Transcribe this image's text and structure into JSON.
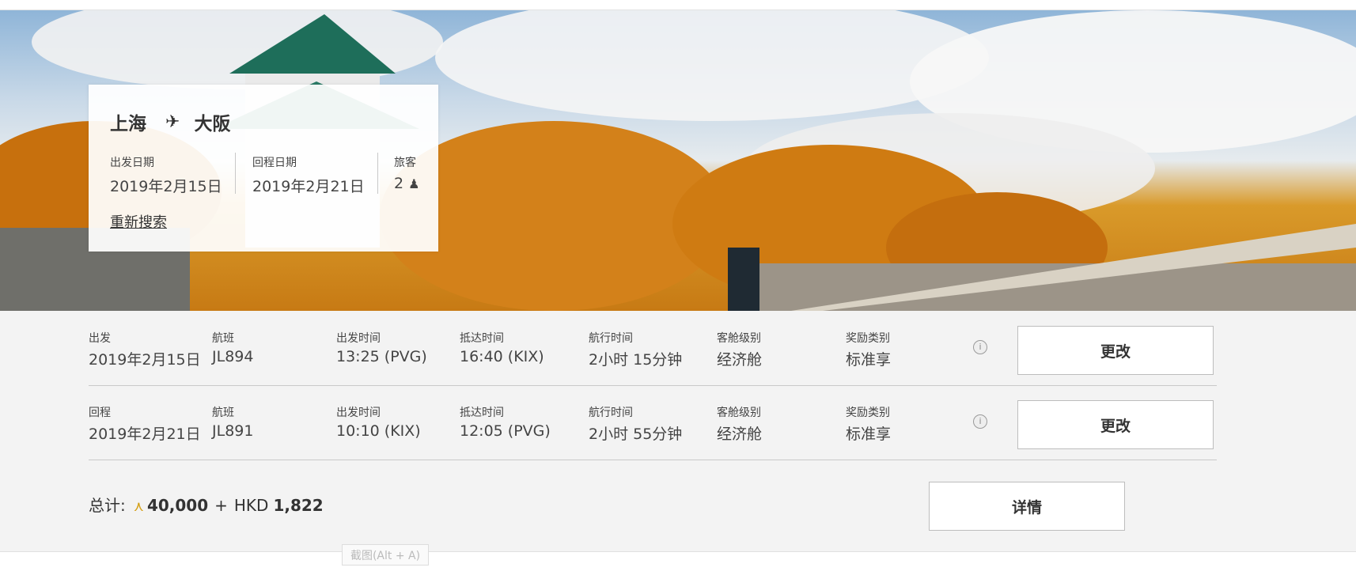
{
  "search": {
    "origin": "上海",
    "destination": "大阪",
    "route_icon": "plane-icon",
    "depart_label": "出发日期",
    "depart_value": "2019年2月15日",
    "return_label": "回程日期",
    "return_value": "2019年2月21日",
    "pax_label": "旅客",
    "pax_value": "2",
    "pax_icon": "person-icon",
    "research_label": "重新搜索"
  },
  "flights": [
    {
      "leg_label": "出发",
      "leg_date": "2019年2月15日",
      "flight_label": "航班",
      "flight_no": "JL894",
      "dep_label": "出发时间",
      "dep_time": "13:25 (PVG)",
      "arr_label": "抵达时间",
      "arr_time": "16:40 (KIX)",
      "dur_label": "航行时间",
      "duration": "2小时 15分钟",
      "cabin_label": "客舱级别",
      "cabin": "经济舱",
      "reward_label": "奖励类别",
      "reward": "标准享",
      "button": "更改"
    },
    {
      "leg_label": "回程",
      "leg_date": "2019年2月21日",
      "flight_label": "航班",
      "flight_no": "JL891",
      "dep_label": "出发时间",
      "dep_time": "10:10 (KIX)",
      "arr_label": "抵达时间",
      "arr_time": "12:05 (PVG)",
      "dur_label": "航行时间",
      "duration": "2小时 55分钟",
      "cabin_label": "客舱级别",
      "cabin": "经济舱",
      "reward_label": "奖励类别",
      "reward": "标准享",
      "button": "更改"
    }
  ],
  "total": {
    "label": "总计:",
    "avios_symbol": "⋏",
    "avios": "40,000",
    "plus": "+",
    "currency": "HKD",
    "amount": "1,822",
    "details_button": "详情"
  },
  "tooltip": "截图(Alt + A)",
  "colors": {
    "panel_bg": "#f3f3f3",
    "avios_accent": "#d4a017"
  }
}
